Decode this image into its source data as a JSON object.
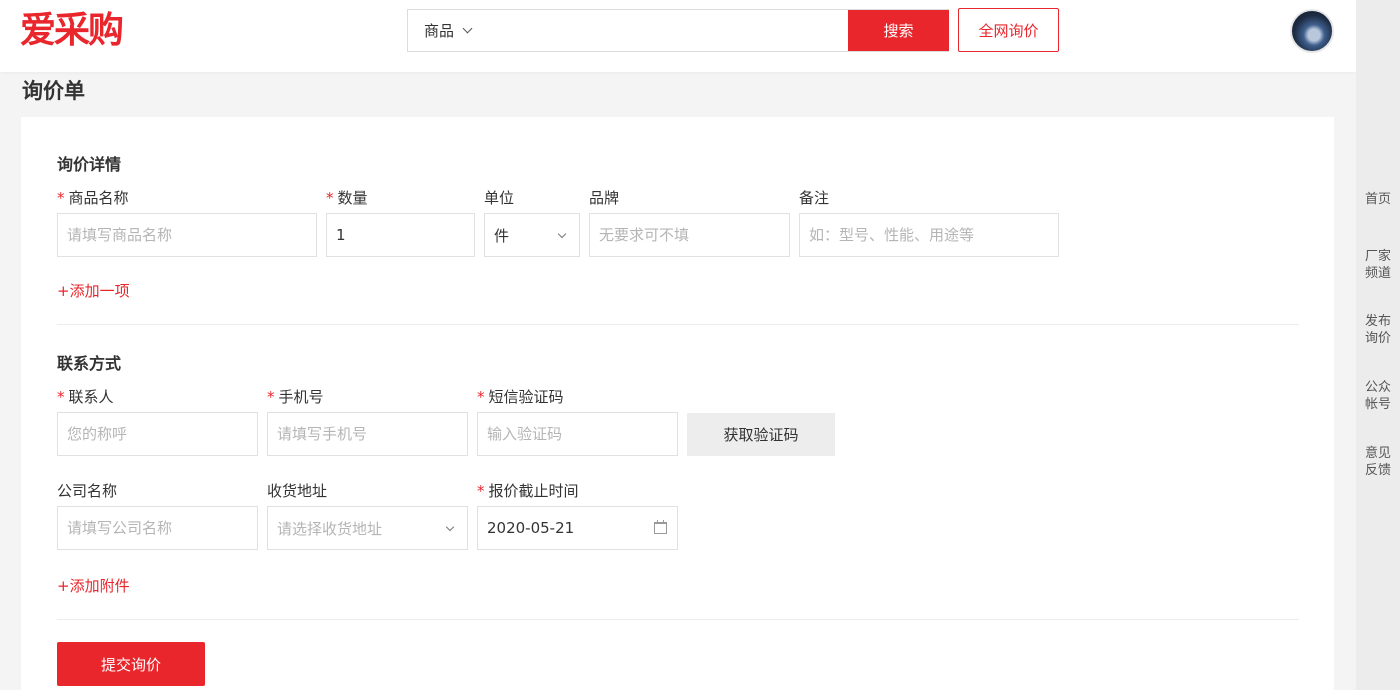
{
  "header": {
    "logo": "爱采购",
    "search": {
      "category": "商品",
      "value": "",
      "button": "搜索"
    },
    "inquiry_button": "全网询价"
  },
  "rail": [
    "首页",
    "厂家\n频道",
    "发布\n询价",
    "公众\n帐号",
    "意见\n反馈"
  ],
  "page_title": "询价单",
  "details": {
    "title": "询价详情",
    "product_label": "商品名称",
    "product_placeholder": "请填写商品名称",
    "qty_label": "数量",
    "qty_value": "1",
    "unit_label": "单位",
    "unit_value": "件",
    "brand_label": "品牌",
    "brand_placeholder": "无要求可不填",
    "note_label": "备注",
    "note_placeholder": "如：型号、性能、用途等",
    "add_item": "+添加一项"
  },
  "contact": {
    "title": "联系方式",
    "person_label": "联系人",
    "person_placeholder": "您的称呼",
    "phone_label": "手机号",
    "phone_placeholder": "请填写手机号",
    "sms_label": "短信验证码",
    "sms_placeholder": "输入验证码",
    "get_code": "获取验证码",
    "company_label": "公司名称",
    "company_placeholder": "请填写公司名称",
    "address_label": "收货地址",
    "address_placeholder": "请选择收货地址",
    "deadline_label": "报价截止时间",
    "deadline_value": "2020-05-21",
    "add_attachment": "+添加附件"
  },
  "submit": "提交询价",
  "colors": {
    "accent": "#e8262c"
  }
}
